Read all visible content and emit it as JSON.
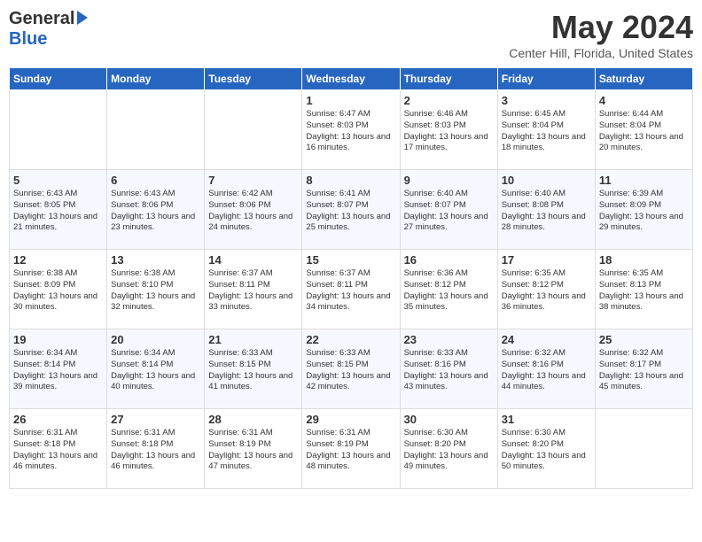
{
  "header": {
    "logo_line1": "General",
    "logo_line2": "Blue",
    "month": "May 2024",
    "location": "Center Hill, Florida, United States"
  },
  "days_of_week": [
    "Sunday",
    "Monday",
    "Tuesday",
    "Wednesday",
    "Thursday",
    "Friday",
    "Saturday"
  ],
  "weeks": [
    {
      "cells": [
        {
          "day": "",
          "sunrise": "",
          "sunset": "",
          "daylight": ""
        },
        {
          "day": "",
          "sunrise": "",
          "sunset": "",
          "daylight": ""
        },
        {
          "day": "",
          "sunrise": "",
          "sunset": "",
          "daylight": ""
        },
        {
          "day": "1",
          "sunrise": "Sunrise: 6:47 AM",
          "sunset": "Sunset: 8:03 PM",
          "daylight": "Daylight: 13 hours and 16 minutes."
        },
        {
          "day": "2",
          "sunrise": "Sunrise: 6:46 AM",
          "sunset": "Sunset: 8:03 PM",
          "daylight": "Daylight: 13 hours and 17 minutes."
        },
        {
          "day": "3",
          "sunrise": "Sunrise: 6:45 AM",
          "sunset": "Sunset: 8:04 PM",
          "daylight": "Daylight: 13 hours and 18 minutes."
        },
        {
          "day": "4",
          "sunrise": "Sunrise: 6:44 AM",
          "sunset": "Sunset: 8:04 PM",
          "daylight": "Daylight: 13 hours and 20 minutes."
        }
      ]
    },
    {
      "cells": [
        {
          "day": "5",
          "sunrise": "Sunrise: 6:43 AM",
          "sunset": "Sunset: 8:05 PM",
          "daylight": "Daylight: 13 hours and 21 minutes."
        },
        {
          "day": "6",
          "sunrise": "Sunrise: 6:43 AM",
          "sunset": "Sunset: 8:06 PM",
          "daylight": "Daylight: 13 hours and 23 minutes."
        },
        {
          "day": "7",
          "sunrise": "Sunrise: 6:42 AM",
          "sunset": "Sunset: 8:06 PM",
          "daylight": "Daylight: 13 hours and 24 minutes."
        },
        {
          "day": "8",
          "sunrise": "Sunrise: 6:41 AM",
          "sunset": "Sunset: 8:07 PM",
          "daylight": "Daylight: 13 hours and 25 minutes."
        },
        {
          "day": "9",
          "sunrise": "Sunrise: 6:40 AM",
          "sunset": "Sunset: 8:07 PM",
          "daylight": "Daylight: 13 hours and 27 minutes."
        },
        {
          "day": "10",
          "sunrise": "Sunrise: 6:40 AM",
          "sunset": "Sunset: 8:08 PM",
          "daylight": "Daylight: 13 hours and 28 minutes."
        },
        {
          "day": "11",
          "sunrise": "Sunrise: 6:39 AM",
          "sunset": "Sunset: 8:09 PM",
          "daylight": "Daylight: 13 hours and 29 minutes."
        }
      ]
    },
    {
      "cells": [
        {
          "day": "12",
          "sunrise": "Sunrise: 6:38 AM",
          "sunset": "Sunset: 8:09 PM",
          "daylight": "Daylight: 13 hours and 30 minutes."
        },
        {
          "day": "13",
          "sunrise": "Sunrise: 6:38 AM",
          "sunset": "Sunset: 8:10 PM",
          "daylight": "Daylight: 13 hours and 32 minutes."
        },
        {
          "day": "14",
          "sunrise": "Sunrise: 6:37 AM",
          "sunset": "Sunset: 8:11 PM",
          "daylight": "Daylight: 13 hours and 33 minutes."
        },
        {
          "day": "15",
          "sunrise": "Sunrise: 6:37 AM",
          "sunset": "Sunset: 8:11 PM",
          "daylight": "Daylight: 13 hours and 34 minutes."
        },
        {
          "day": "16",
          "sunrise": "Sunrise: 6:36 AM",
          "sunset": "Sunset: 8:12 PM",
          "daylight": "Daylight: 13 hours and 35 minutes."
        },
        {
          "day": "17",
          "sunrise": "Sunrise: 6:35 AM",
          "sunset": "Sunset: 8:12 PM",
          "daylight": "Daylight: 13 hours and 36 minutes."
        },
        {
          "day": "18",
          "sunrise": "Sunrise: 6:35 AM",
          "sunset": "Sunset: 8:13 PM",
          "daylight": "Daylight: 13 hours and 38 minutes."
        }
      ]
    },
    {
      "cells": [
        {
          "day": "19",
          "sunrise": "Sunrise: 6:34 AM",
          "sunset": "Sunset: 8:14 PM",
          "daylight": "Daylight: 13 hours and 39 minutes."
        },
        {
          "day": "20",
          "sunrise": "Sunrise: 6:34 AM",
          "sunset": "Sunset: 8:14 PM",
          "daylight": "Daylight: 13 hours and 40 minutes."
        },
        {
          "day": "21",
          "sunrise": "Sunrise: 6:33 AM",
          "sunset": "Sunset: 8:15 PM",
          "daylight": "Daylight: 13 hours and 41 minutes."
        },
        {
          "day": "22",
          "sunrise": "Sunrise: 6:33 AM",
          "sunset": "Sunset: 8:15 PM",
          "daylight": "Daylight: 13 hours and 42 minutes."
        },
        {
          "day": "23",
          "sunrise": "Sunrise: 6:33 AM",
          "sunset": "Sunset: 8:16 PM",
          "daylight": "Daylight: 13 hours and 43 minutes."
        },
        {
          "day": "24",
          "sunrise": "Sunrise: 6:32 AM",
          "sunset": "Sunset: 8:16 PM",
          "daylight": "Daylight: 13 hours and 44 minutes."
        },
        {
          "day": "25",
          "sunrise": "Sunrise: 6:32 AM",
          "sunset": "Sunset: 8:17 PM",
          "daylight": "Daylight: 13 hours and 45 minutes."
        }
      ]
    },
    {
      "cells": [
        {
          "day": "26",
          "sunrise": "Sunrise: 6:31 AM",
          "sunset": "Sunset: 8:18 PM",
          "daylight": "Daylight: 13 hours and 46 minutes."
        },
        {
          "day": "27",
          "sunrise": "Sunrise: 6:31 AM",
          "sunset": "Sunset: 8:18 PM",
          "daylight": "Daylight: 13 hours and 46 minutes."
        },
        {
          "day": "28",
          "sunrise": "Sunrise: 6:31 AM",
          "sunset": "Sunset: 8:19 PM",
          "daylight": "Daylight: 13 hours and 47 minutes."
        },
        {
          "day": "29",
          "sunrise": "Sunrise: 6:31 AM",
          "sunset": "Sunset: 8:19 PM",
          "daylight": "Daylight: 13 hours and 48 minutes."
        },
        {
          "day": "30",
          "sunrise": "Sunrise: 6:30 AM",
          "sunset": "Sunset: 8:20 PM",
          "daylight": "Daylight: 13 hours and 49 minutes."
        },
        {
          "day": "31",
          "sunrise": "Sunrise: 6:30 AM",
          "sunset": "Sunset: 8:20 PM",
          "daylight": "Daylight: 13 hours and 50 minutes."
        },
        {
          "day": "",
          "sunrise": "",
          "sunset": "",
          "daylight": ""
        }
      ]
    }
  ]
}
